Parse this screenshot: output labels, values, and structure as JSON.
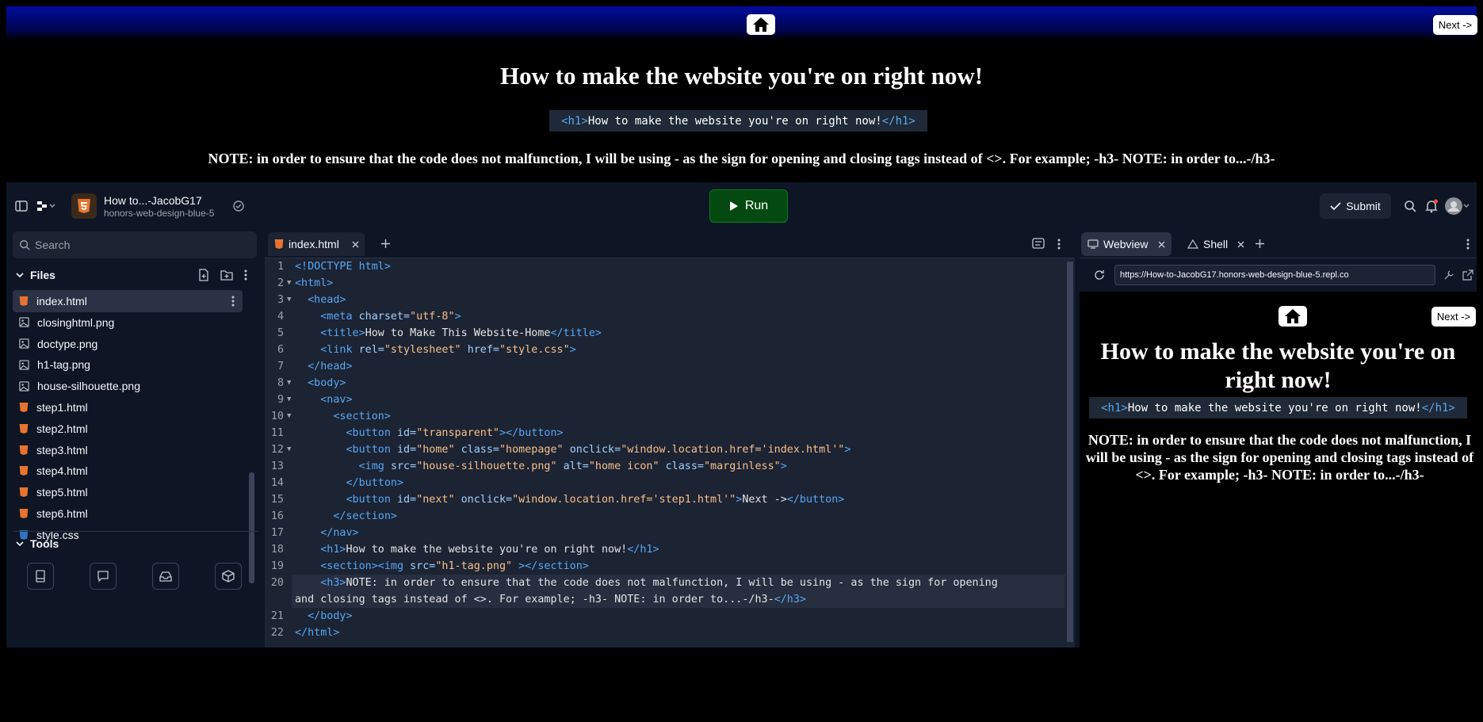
{
  "tutorial": {
    "next_label": "Next ->",
    "heading": "How to make the website you're on right now!",
    "code_sample": "<h1>How to make the website you're on right now!</h1>",
    "note": "NOTE: in order to ensure that the code does not malfunction, I will be using - as the sign for opening and closing tags instead of <>. For example; -h3- NOTE: in order to...-/h3-"
  },
  "titlebar": {
    "project_name": "How to...-JacobG17",
    "project_sub": "honors-web-design-blue-5",
    "run_label": "Run",
    "submit_label": "Submit"
  },
  "sidebar": {
    "search_placeholder": "Search",
    "files_label": "Files",
    "tools_label": "Tools",
    "files": [
      {
        "name": "index.html",
        "icon": "html-file-icon"
      },
      {
        "name": "closinghtml.png",
        "icon": "image-file-icon"
      },
      {
        "name": "doctype.png",
        "icon": "image-file-icon"
      },
      {
        "name": "h1-tag.png",
        "icon": "image-file-icon"
      },
      {
        "name": "house-silhouette.png",
        "icon": "image-file-icon"
      },
      {
        "name": "step1.html",
        "icon": "html-file-icon"
      },
      {
        "name": "step2.html",
        "icon": "html-file-icon"
      },
      {
        "name": "step3.html",
        "icon": "html-file-icon"
      },
      {
        "name": "step4.html",
        "icon": "html-file-icon"
      },
      {
        "name": "step5.html",
        "icon": "html-file-icon"
      },
      {
        "name": "step6.html",
        "icon": "html-file-icon"
      },
      {
        "name": "style.css",
        "icon": "css-file-icon"
      }
    ]
  },
  "editor": {
    "tab_label": "index.html",
    "lines": [
      "1",
      "2",
      "3",
      "4",
      "5",
      "6",
      "7",
      "8",
      "9",
      "10",
      "11",
      "12",
      "13",
      "14",
      "15",
      "16",
      "17",
      "18",
      "19",
      "20",
      "",
      "21",
      "22"
    ]
  },
  "webview": {
    "tab_webview": "Webview",
    "tab_shell": "Shell",
    "url": "https://How-to-JacobG17.honors-web-design-blue-5.repl.co",
    "next_label": "Next ->",
    "heading": "How to make the website you're on right now!",
    "code_sample": "<h1>How to make the website you're on right now!</h1>",
    "note": "NOTE: in order to ensure that the code does not malfunction, I will be using - as the sign for opening and closing tags instead of <>. For example; -h3- NOTE: in order to...-/h3-"
  },
  "colors": {
    "run_green": "#044a10",
    "html_icon": "#e8732e",
    "css_icon": "#2f74c0",
    "tag_blue": "#56a8f5",
    "string_orange": "#f8c08a"
  }
}
